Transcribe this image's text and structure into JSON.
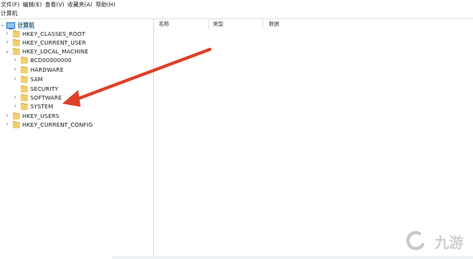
{
  "menu": {
    "items": [
      "文件(F)",
      "编辑(E)",
      "查看(V)",
      "收藏夹(A)",
      "帮助(H)"
    ]
  },
  "path": "计算机",
  "tree": {
    "root": "计算机",
    "items": [
      "HKEY_CLASSES_ROOT",
      "HKEY_CURRENT_USER",
      "HKEY_LOCAL_MACHINE",
      "BCD00000000",
      "HARDWARE",
      "SAM",
      "SECURITY",
      "SOFTWARE",
      "SYSTEM",
      "HKEY_USERS",
      "HKEY_CURRENT_CONFIG"
    ]
  },
  "columns": {
    "name": "名称",
    "type": "类型",
    "data": "数据"
  },
  "annotation": {
    "color": "#e0402a"
  },
  "watermark": {
    "text": "九游"
  },
  "colors": {
    "selection": "#cce8ff",
    "folder": "#f3cf6c"
  }
}
